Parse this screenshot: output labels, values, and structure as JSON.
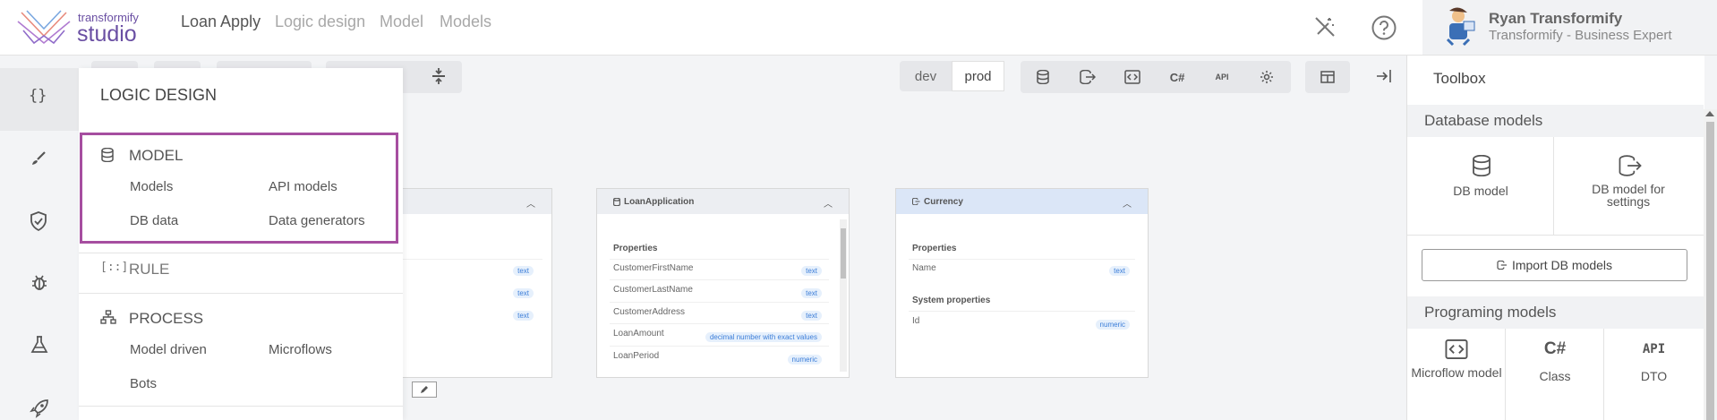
{
  "colors": {
    "brand_purple": "#6a4fa3",
    "highlight_border": "#a64ea0",
    "badge_blue": "#3b7dd8"
  },
  "header": {
    "logo_small": "transformify",
    "logo_large": "studio",
    "nav": [
      "Loan Apply",
      "Logic design",
      "Model",
      "Models"
    ],
    "user_name": "Ryan Transformify",
    "user_role": "Transformify - Business Expert"
  },
  "rail_icons": [
    "code-braces-icon",
    "brush-icon",
    "shield-icon",
    "bug-icon",
    "flask-icon",
    "rocket-icon"
  ],
  "flyout": {
    "title": "LOGIC DESIGN",
    "model_section": {
      "title": "MODEL",
      "links": [
        "Models",
        "API models",
        "DB data",
        "Data generators"
      ]
    },
    "rule_section": {
      "title": "RULE"
    },
    "process_section": {
      "title": "PROCESS",
      "links": [
        "Model driven",
        "Microflows",
        "Bots"
      ]
    }
  },
  "toolbar": {
    "env_dev": "dev",
    "env_prod": "prod",
    "buttons": [
      "database-icon",
      "db-export-icon",
      "microflow-icon",
      "C#",
      "API",
      "gear-icon",
      "table-icon",
      "collapse-right-icon"
    ]
  },
  "cards": [
    {
      "title": "",
      "props": [
        {
          "type": "text"
        },
        {
          "type": "text"
        },
        {
          "type": "text"
        }
      ]
    },
    {
      "title": "LoanApplication",
      "properties_label": "Properties",
      "props": [
        {
          "name": "CustomerFirstName",
          "type": "text"
        },
        {
          "name": "CustomerLastName",
          "type": "text"
        },
        {
          "name": "CustomerAddress",
          "type": "text"
        },
        {
          "name": "LoanAmount",
          "type": "decimal number with exact values"
        },
        {
          "name": "LoanPeriod",
          "type": "numeric"
        }
      ]
    },
    {
      "title": "Currency",
      "properties_label": "Properties",
      "props": [
        {
          "name": "Name",
          "type": "text"
        }
      ],
      "system_label": "System properties",
      "system_props": [
        {
          "name": "Id",
          "type": "numeric"
        }
      ]
    }
  ],
  "toolbox": {
    "title": "Toolbox",
    "db_section": "Database models",
    "db_tiles": [
      "DB model",
      "DB model for settings"
    ],
    "import_button": "Import DB models",
    "prog_section": "Programing models",
    "prog_tiles": [
      {
        "icon_text": "{}",
        "label": "Microflow model"
      },
      {
        "icon_text": "C#",
        "label": "Class"
      },
      {
        "icon_text": "API",
        "label": "DTO"
      }
    ]
  }
}
